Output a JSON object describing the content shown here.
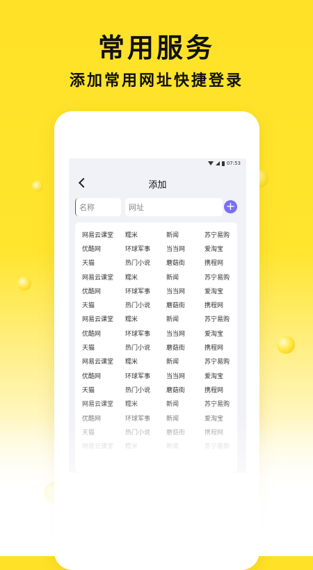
{
  "hero": {
    "title": "常用服务",
    "subtitle": "添加常用网址快捷登录"
  },
  "status_bar": {
    "time": "07:53",
    "icons": [
      "wifi-icon",
      "signal-icon",
      "battery-icon"
    ]
  },
  "screen": {
    "title": "添加",
    "back_icon": "chevron-left-icon",
    "name_placeholder": "名称",
    "url_placeholder": "网址",
    "add_icon": "plus-icon"
  },
  "sites": [
    [
      "网易云课堂",
      "糯米",
      "新闻",
      "苏宁易购"
    ],
    [
      "优酷网",
      "环球军事",
      "当当网",
      "爱淘宝"
    ],
    [
      "天猫",
      "热门小说",
      "蘑菇街",
      "携程网"
    ],
    [
      "网易云课堂",
      "糯米",
      "新闻",
      "苏宁易购"
    ],
    [
      "优酷网",
      "环球军事",
      "当当网",
      "爱淘宝"
    ],
    [
      "天猫",
      "热门小说",
      "蘑菇街",
      "携程网"
    ],
    [
      "网易云课堂",
      "糯米",
      "新闻",
      "苏宁易购"
    ],
    [
      "优酷网",
      "环球军事",
      "当当网",
      "爱淘宝"
    ],
    [
      "天猫",
      "热门小说",
      "蘑菇街",
      "携程网"
    ],
    [
      "网易云课堂",
      "糯米",
      "新闻",
      "苏宁易购"
    ],
    [
      "优酷网",
      "环球军事",
      "当当网",
      "爱淘宝"
    ],
    [
      "天猫",
      "热门小说",
      "蘑菇街",
      "携程网"
    ],
    [
      "网易云课堂",
      "糯米",
      "新闻",
      "苏宁易购"
    ],
    [
      "优酷网",
      "环球军事",
      "新闻",
      "爱淘宝"
    ],
    [
      "天猫",
      "热门小说",
      "蘑菇街",
      "携程网"
    ],
    [
      "网易云课堂",
      "糯米",
      "新闻",
      "苏宁易购"
    ]
  ],
  "colors": {
    "background": "#ffe227",
    "accent": "#7a6ef5",
    "screen_bg": "#f1f1f8"
  }
}
